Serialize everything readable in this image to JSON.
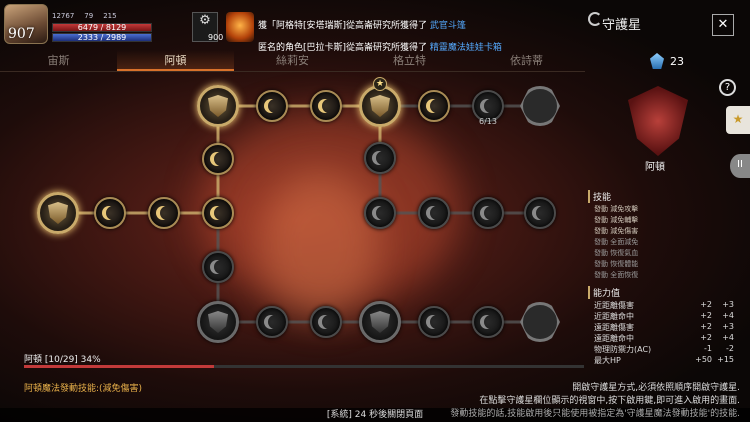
{
  "player": {
    "level": "907",
    "stat1": "12767",
    "stat2": "79",
    "stat3": "215",
    "hp": "6479 / 8129",
    "mp": "2333 / 2989",
    "potion_count": "900"
  },
  "news": [
    {
      "pre": "獲「阿格特[安塔瑞斯]從高崙研究所獲得了 ",
      "highlight": "武官斗篷",
      "post": ""
    },
    {
      "pre": "匿名的角色[巴拉卡斯]從高崙研究所獲得了 ",
      "highlight": "精靈魔法娃娃卡箱",
      "post": ""
    }
  ],
  "tabs": [
    {
      "label": "宙斯",
      "active": false
    },
    {
      "label": "阿頓",
      "active": true
    },
    {
      "label": "絲莉安",
      "active": false
    },
    {
      "label": "格立特",
      "active": false
    },
    {
      "label": "依詩蒂",
      "active": false
    }
  ],
  "node_counter": "6/13",
  "progress": {
    "label": "阿頓 [10/29] 34%",
    "value": 0.34
  },
  "skill_message": "阿頓魔法發動技能:(減免傷害)",
  "help_lines": [
    "開啟守護星方式,必須依照順序開啟守護星.",
    "在點擊守護星欄位顯示的視窗中,按下啟用鍵,即可進入啟用的畫面.",
    "發動技能的話,技能啟用後只能使用被指定為'守護星魔法發動技能'的技能."
  ],
  "system_message": "[系統] 24 秒後關閉頁面",
  "panel": {
    "title": "守護星",
    "close": "✕",
    "crystal_count": "23",
    "help": "?",
    "guardian_name": "阿頓",
    "skills_heading": "技能",
    "skills": [
      {
        "name": "發動 減免攻擊",
        "lit": true
      },
      {
        "name": "發動 減免輔擊",
        "lit": true
      },
      {
        "name": "發動 減免傷害",
        "lit": true
      },
      {
        "name": "發動 全面減免",
        "lit": false
      },
      {
        "name": "發動 恢復氣血",
        "lit": false
      },
      {
        "name": "發動 恢復體能",
        "lit": false
      },
      {
        "name": "發動 全面恢復",
        "lit": false
      }
    ],
    "abilities_heading": "能力值",
    "abilities": [
      {
        "name": "近距離傷害",
        "v1": "+2",
        "v2": "+3"
      },
      {
        "name": "近距離命中",
        "v1": "+2",
        "v2": "+4"
      },
      {
        "name": "遠距離傷害",
        "v1": "+2",
        "v2": "+3"
      },
      {
        "name": "遠距離命中",
        "v1": "+2",
        "v2": "+4"
      },
      {
        "name": "物理防禦力(AC)",
        "v1": "-1",
        "v2": "-2"
      },
      {
        "name": "最大HP",
        "v1": "+50",
        "v2": "+15"
      }
    ]
  },
  "colors": {
    "accent": "#d9722b",
    "gold": "#c9aa6a",
    "hp": "#c23a3a",
    "mp": "#4b6fd1",
    "news_highlight": "#55aaff"
  }
}
